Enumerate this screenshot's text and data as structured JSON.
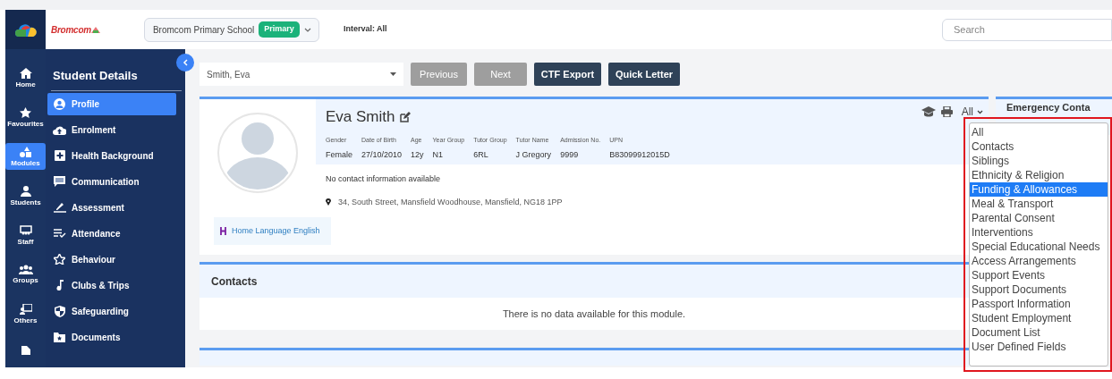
{
  "brand": "Bromcom",
  "nav_rail": [
    {
      "label": "Home",
      "selected": false
    },
    {
      "label": "Favourites",
      "selected": false
    },
    {
      "label": "Modules",
      "selected": true
    },
    {
      "label": "Students",
      "selected": false
    },
    {
      "label": "Staff",
      "selected": false
    },
    {
      "label": "Groups",
      "selected": false
    },
    {
      "label": "Others",
      "selected": false
    }
  ],
  "school_selector": {
    "name": "Bromcom Primary School",
    "badge": "Primary"
  },
  "interval": "Interval: All",
  "search": {
    "placeholder": "Search"
  },
  "sidebar": {
    "title": "Student Details",
    "items": [
      {
        "label": "Profile",
        "selected": true
      },
      {
        "label": "Enrolment",
        "selected": false
      },
      {
        "label": "Health Background",
        "selected": false
      },
      {
        "label": "Communication",
        "selected": false
      },
      {
        "label": "Assessment",
        "selected": false
      },
      {
        "label": "Attendance",
        "selected": false
      },
      {
        "label": "Behaviour",
        "selected": false
      },
      {
        "label": "Clubs & Trips",
        "selected": false
      },
      {
        "label": "Safeguarding",
        "selected": false
      },
      {
        "label": "Documents",
        "selected": false
      }
    ]
  },
  "student_select": {
    "value": "Smith, Eva"
  },
  "buttons": [
    {
      "label": "Previous",
      "disabled": true
    },
    {
      "label": "Next",
      "disabled": true
    },
    {
      "label": "CTF Export",
      "disabled": false
    },
    {
      "label": "Quick Letter",
      "disabled": false
    }
  ],
  "profile": {
    "name": "Eva Smith",
    "section_select": "All",
    "fields": [
      {
        "label": "Gender",
        "value": "Female"
      },
      {
        "label": "Date of Birth",
        "value": "27/10/2010"
      },
      {
        "label": "Age",
        "value": "12y"
      },
      {
        "label": "Year Group",
        "value": "N1"
      },
      {
        "label": "Tutor Group",
        "value": "6RL"
      },
      {
        "label": "Tutor Name",
        "value": "J Gregory"
      },
      {
        "label": "Admission No.",
        "value": "9999"
      },
      {
        "label": "UPN",
        "value": "B83099912015D"
      }
    ],
    "contact_info": "No contact information available",
    "address": "34, South Street, Mansfield Woodhouse, Mansfield, NG18 1PP",
    "home_language": "Home Language English"
  },
  "section_options": [
    {
      "label": "All",
      "selected": false
    },
    {
      "label": "Contacts",
      "selected": false
    },
    {
      "label": "Siblings",
      "selected": false
    },
    {
      "label": "Ethnicity & Religion",
      "selected": false
    },
    {
      "label": "Funding & Allowances",
      "selected": true
    },
    {
      "label": "Meal & Transport",
      "selected": false
    },
    {
      "label": "Parental Consent",
      "selected": false
    },
    {
      "label": "Interventions",
      "selected": false
    },
    {
      "label": "Special Educational Needs",
      "selected": false
    },
    {
      "label": "Access Arrangements",
      "selected": false
    },
    {
      "label": "Support Events",
      "selected": false
    },
    {
      "label": "Support Documents",
      "selected": false
    },
    {
      "label": "Passport Information",
      "selected": false
    },
    {
      "label": "Student Employment",
      "selected": false
    },
    {
      "label": "Document List",
      "selected": false
    },
    {
      "label": "User Defined Fields",
      "selected": false
    }
  ],
  "emergency_title": "Emergency Conta",
  "contacts": {
    "title": "Contacts",
    "empty_message": "There is no data available for this module."
  }
}
